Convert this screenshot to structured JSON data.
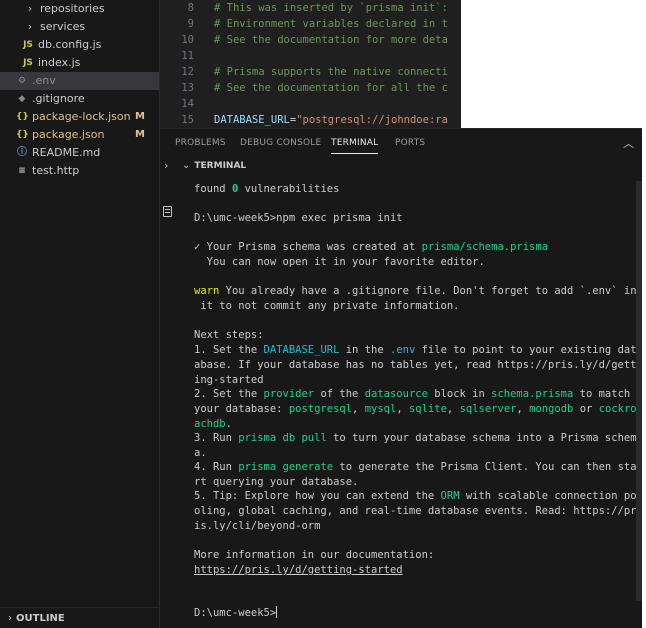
{
  "explorer": {
    "items": [
      {
        "type": "folder",
        "label": "repositories",
        "icon": "chevron-right-icon"
      },
      {
        "type": "folder",
        "label": "services",
        "icon": "chevron-right-icon"
      },
      {
        "type": "js",
        "label": "db.config.js",
        "icon_text": "JS"
      },
      {
        "type": "js",
        "label": "index.js",
        "icon_text": "JS"
      },
      {
        "type": "env",
        "label": ".env",
        "icon": "gear-icon",
        "selected": true
      },
      {
        "type": "git",
        "label": ".gitignore",
        "icon": "diamond-icon"
      },
      {
        "type": "json",
        "label": "package-lock.json",
        "icon_text": "{}",
        "status": "M"
      },
      {
        "type": "json",
        "label": "package.json",
        "icon_text": "{}",
        "status": "M"
      },
      {
        "type": "md",
        "label": "README.md",
        "icon": "info-icon"
      },
      {
        "type": "http",
        "label": "test.http",
        "icon": "list-icon"
      }
    ],
    "outline_label": "OUTLINE"
  },
  "editor": {
    "lines": [
      {
        "num": "8",
        "text": "# This was inserted by `prisma init`:"
      },
      {
        "num": "9",
        "text": "# Environment variables declared in t"
      },
      {
        "num": "10",
        "text": "# See the documentation for more deta"
      },
      {
        "num": "11",
        "text": ""
      },
      {
        "num": "12",
        "text": "# Prisma supports the native connecti"
      },
      {
        "num": "13",
        "text": "# See the documentation for all the c"
      },
      {
        "num": "14",
        "text": ""
      },
      {
        "num": "15",
        "key": "DATABASE_URL",
        "op": "=",
        "value": "\"postgresql://johndoe:ra"
      }
    ]
  },
  "panel": {
    "tabs": [
      "PROBLEMS",
      "DEBUG CONSOLE",
      "TERMINAL",
      "PORTS"
    ],
    "active_tab": "TERMINAL",
    "section_title": "TERMINAL",
    "terminal": {
      "found_prefix": "found ",
      "found_count": "0",
      "found_suffix": " vulnerabilities",
      "prompt1": "D:\\umc-week5>npm exec prisma init",
      "check": "✓",
      "created_text": " Your Prisma schema was created at ",
      "schema_path": "prisma/schema.prisma",
      "open_text": "  You can now open it in your favorite editor.",
      "warn": "warn",
      "warn_line1": " You already have a .gitignore file. Don't forget to add `.env` in",
      "warn_line2": " it to not commit any private information.",
      "next_steps": "Next steps:",
      "s1_a": "1. Set the ",
      "s1_b": "DATABASE_URL",
      "s1_c": " in the ",
      "s1_d": ".env",
      "s1_e": " file to point to your existing dat",
      "s1_l2": "abase. If your database has no tables yet, read https://pris.ly/d/gett",
      "s1_l3": "ing-started",
      "s2_a": "2. Set the ",
      "s2_b": "provider",
      "s2_c": " of the ",
      "s2_d": "datasource",
      "s2_e": " block in ",
      "s2_f": "schema.prisma",
      "s2_g": " to match",
      "s2_l2a": "your database: ",
      "s2_pg": "postgresql",
      "s2_sep1": ", ",
      "s2_my": "mysql",
      "s2_sep2": ", ",
      "s2_sq": "sqlite",
      "s2_sep3": ", ",
      "s2_ss": "sqlserver",
      "s2_sep4": ", ",
      "s2_mo": "mongodb",
      "s2_or": " or ",
      "s2_co": "cockro",
      "s2_l3": "achdb",
      "s2_l3_end": ".",
      "s3_a": "3. Run ",
      "s3_b": "prisma db pull",
      "s3_c": " to turn your database schema into a Prisma schem",
      "s3_l2": "a.",
      "s4_a": "4. Run ",
      "s4_b": "prisma generate",
      "s4_c": " to generate the Prisma Client. You can then sta",
      "s4_l2": "rt querying your database.",
      "s5_a": "5. Tip: Explore how you can extend the ",
      "s5_b": "ORM",
      "s5_c": " with scalable connection po",
      "s5_l2": "oling, global caching, and real-time database events. Read: https://pr",
      "s5_l3": "is.ly/cli/beyond-orm",
      "more_info": "More information in our documentation:",
      "doc_link": "https://pris.ly/d/getting-started",
      "prompt2": "D:\\umc-week5>"
    }
  },
  "colors": {
    "sidebar_bg": "#181818",
    "editor_bg": "#1f1f1f",
    "terminal_green": "#23d18b",
    "terminal_yellow": "#e5e510",
    "terminal_cyan": "#29b8db",
    "modified": "#e2c08d"
  }
}
